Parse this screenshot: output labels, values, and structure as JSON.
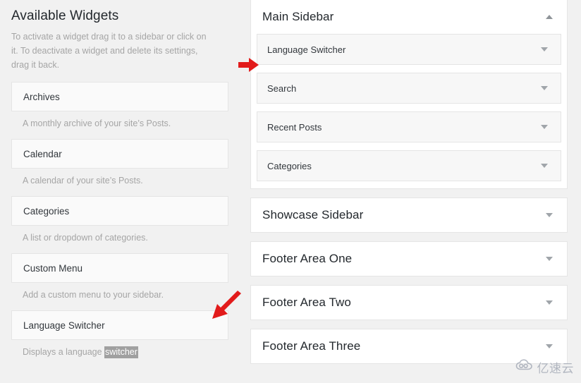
{
  "colors": {
    "page_background": "#f1f1f1",
    "panel_background": "#ffffff",
    "widget_box_background": "#fafafa",
    "widget_row_background": "#f7f7f7",
    "border": "#e5e5e5",
    "heading_text": "#23282d",
    "body_text": "#32373c",
    "muted_text": "#a5a5a5",
    "selection_highlight": "#a0a0a0",
    "annotation_arrow": "#e21b1b",
    "watermark": "#8b93a3"
  },
  "available_widgets": {
    "title": "Available Widgets",
    "description": "To activate a widget drag it to a sidebar or click on it. To deactivate a widget and delete its settings, drag it back.",
    "items": [
      {
        "name": "Archives",
        "description": "A monthly archive of your site’s Posts.",
        "description_plain": "A monthly archive of your site’s Posts.",
        "highlighted_word": ""
      },
      {
        "name": "Calendar",
        "description": "A calendar of your site’s Posts.",
        "description_plain": "A calendar of your site’s Posts.",
        "highlighted_word": ""
      },
      {
        "name": "Categories",
        "description": "A list or dropdown of categories.",
        "description_plain": "A list or dropdown of categories.",
        "highlighted_word": ""
      },
      {
        "name": "Custom Menu",
        "description": "Add a custom menu to your sidebar.",
        "description_plain": "Add a custom menu to your sidebar.",
        "highlighted_word": ""
      },
      {
        "name": "Language Switcher",
        "description": "Displays a language ",
        "description_plain": "Displays a language switcher",
        "highlighted_word": "switcher"
      }
    ]
  },
  "sidebars": [
    {
      "title": "Main Sidebar",
      "toggle_icon": "caret-up-icon",
      "expanded": true,
      "widgets": [
        {
          "name": "Language Switcher",
          "toggle_icon": "caret-down-icon"
        },
        {
          "name": "Search",
          "toggle_icon": "caret-down-icon"
        },
        {
          "name": "Recent Posts",
          "toggle_icon": "caret-down-icon"
        },
        {
          "name": "Categories",
          "toggle_icon": "caret-down-icon"
        }
      ]
    },
    {
      "title": "Showcase Sidebar",
      "toggle_icon": "caret-down-icon",
      "expanded": false,
      "widgets": []
    },
    {
      "title": "Footer Area One",
      "toggle_icon": "caret-down-icon",
      "expanded": false,
      "widgets": []
    },
    {
      "title": "Footer Area Two",
      "toggle_icon": "caret-down-icon",
      "expanded": false,
      "widgets": []
    },
    {
      "title": "Footer Area Three",
      "toggle_icon": "caret-down-icon",
      "expanded": false,
      "widgets": []
    }
  ],
  "annotations": [
    {
      "icon": "red-arrow-right-icon",
      "points_to": "Language Switcher widget in Main Sidebar"
    },
    {
      "icon": "red-arrow-down-left-icon",
      "points_to": "Language Switcher available widget"
    }
  ],
  "watermark": {
    "icon": "cloud-icon",
    "text": "亿速云"
  }
}
